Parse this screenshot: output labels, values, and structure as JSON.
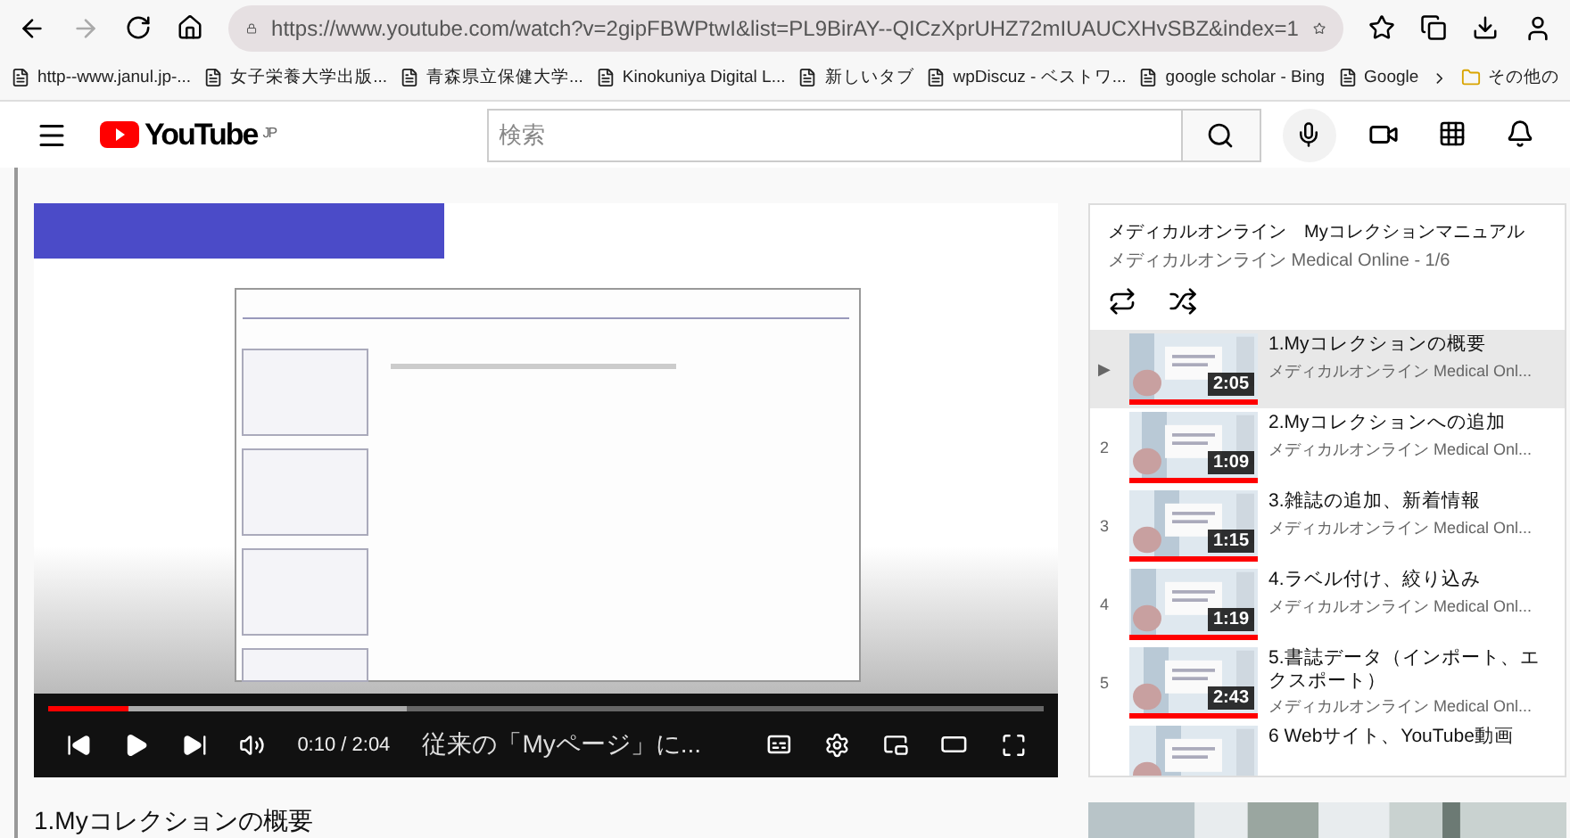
{
  "browser": {
    "url": "https://www.youtube.com/watch?v=2gipFBWPtwI&list=PL9BirAY--QICzXprUHZ72mIUAUCXHvSBZ&index=1",
    "bookmarks": [
      {
        "label": "http--www.janul.jp-..."
      },
      {
        "label": "女子栄養大学出版..."
      },
      {
        "label": "青森県立保健大学..."
      },
      {
        "label": "Kinokuniya Digital L..."
      },
      {
        "label": "新しいタブ"
      },
      {
        "label": "wpDiscuz - ベストワ..."
      },
      {
        "label": "google scholar - Bing"
      },
      {
        "label": "Google"
      }
    ],
    "more": "その他の"
  },
  "header": {
    "logo": "YouTube",
    "region": "JP",
    "search": {
      "placeholder": "検索"
    }
  },
  "player": {
    "time": "0:10 / 2:04",
    "chapter": "従来の「Myページ」に...",
    "level": 0.08
  },
  "below_title": "1.Myコレクションの概要",
  "playlist": {
    "title": "メディカルオンライン　Myコレクションマニュアル",
    "subtitle": "メディカルオンライン Medical Online - 1/6",
    "items": [
      {
        "index": "▶",
        "title": "1.Myコレクションの概要",
        "channel": "メディカルオンライン Medical Onl...",
        "duration": "2:05",
        "selected": true
      },
      {
        "index": "2",
        "title": "2.Myコレクションへの追加",
        "channel": "メディカルオンライン Medical Onl...",
        "duration": "1:09",
        "selected": false
      },
      {
        "index": "3",
        "title": "3.雑誌の追加、新着情報",
        "channel": "メディカルオンライン Medical Onl...",
        "duration": "1:15",
        "selected": false
      },
      {
        "index": "4",
        "title": "4.ラベル付け、絞り込み",
        "channel": "メディカルオンライン Medical Onl...",
        "duration": "1:19",
        "selected": false
      },
      {
        "index": "5",
        "title": "5.書誌データ（インポート、エクスポート）",
        "channel": "メディカルオンライン Medical Onl...",
        "duration": "2:43",
        "selected": false
      },
      {
        "title": "6  Webサイト、YouTube動画",
        "selected": false
      }
    ]
  }
}
